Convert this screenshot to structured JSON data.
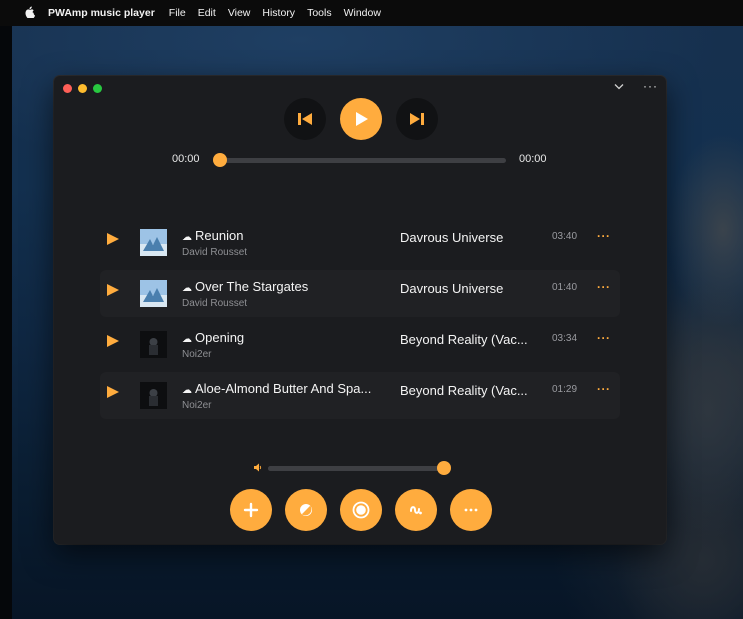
{
  "menubar": {
    "apple_icon": "apple-logo-icon",
    "app_name": "PWAmp music player",
    "items": [
      "File",
      "Edit",
      "View",
      "History",
      "Tools",
      "Window"
    ]
  },
  "window": {
    "traffic_lights": [
      "close",
      "minimize",
      "zoom"
    ],
    "chevron_icon": "chevron-down-icon",
    "more_icon": "more-horizontal-icon",
    "more_label": "···"
  },
  "player": {
    "current_time": "00:00",
    "total_time": "00:00",
    "progress": 0.0,
    "accent": "#ffac3e"
  },
  "tracks": [
    {
      "title": "Reunion",
      "artist": "David Rousset",
      "album": "Davrous Universe",
      "duration": "03:40",
      "art": "blue-sky",
      "highlight": false
    },
    {
      "title": "Over The Stargates",
      "artist": "David Rousset",
      "album": "Davrous Universe",
      "duration": "01:40",
      "art": "blue-sky",
      "highlight": true
    },
    {
      "title": "Opening",
      "artist": "Noi2er",
      "album": "Beyond Reality (Vac...",
      "duration": "03:34",
      "art": "dark-figure",
      "highlight": false
    },
    {
      "title": "Aloe-Almond Butter And Spa...",
      "artist": "Noi2er",
      "album": "Beyond Reality (Vac...",
      "duration": "01:29",
      "art": "dark-figure",
      "highlight": true
    }
  ],
  "track_more_label": "···",
  "volume": {
    "level": 1.0,
    "icon": "speaker-icon",
    "glyph": "🔈"
  },
  "bottom_buttons": [
    {
      "name": "add-button",
      "icon": "plus-icon"
    },
    {
      "name": "theme-button",
      "icon": "contrast-icon"
    },
    {
      "name": "record-button",
      "icon": "record-icon"
    },
    {
      "name": "visualizer-button",
      "icon": "waveform-icon"
    },
    {
      "name": "more-button",
      "icon": "more-horizontal-icon"
    }
  ]
}
